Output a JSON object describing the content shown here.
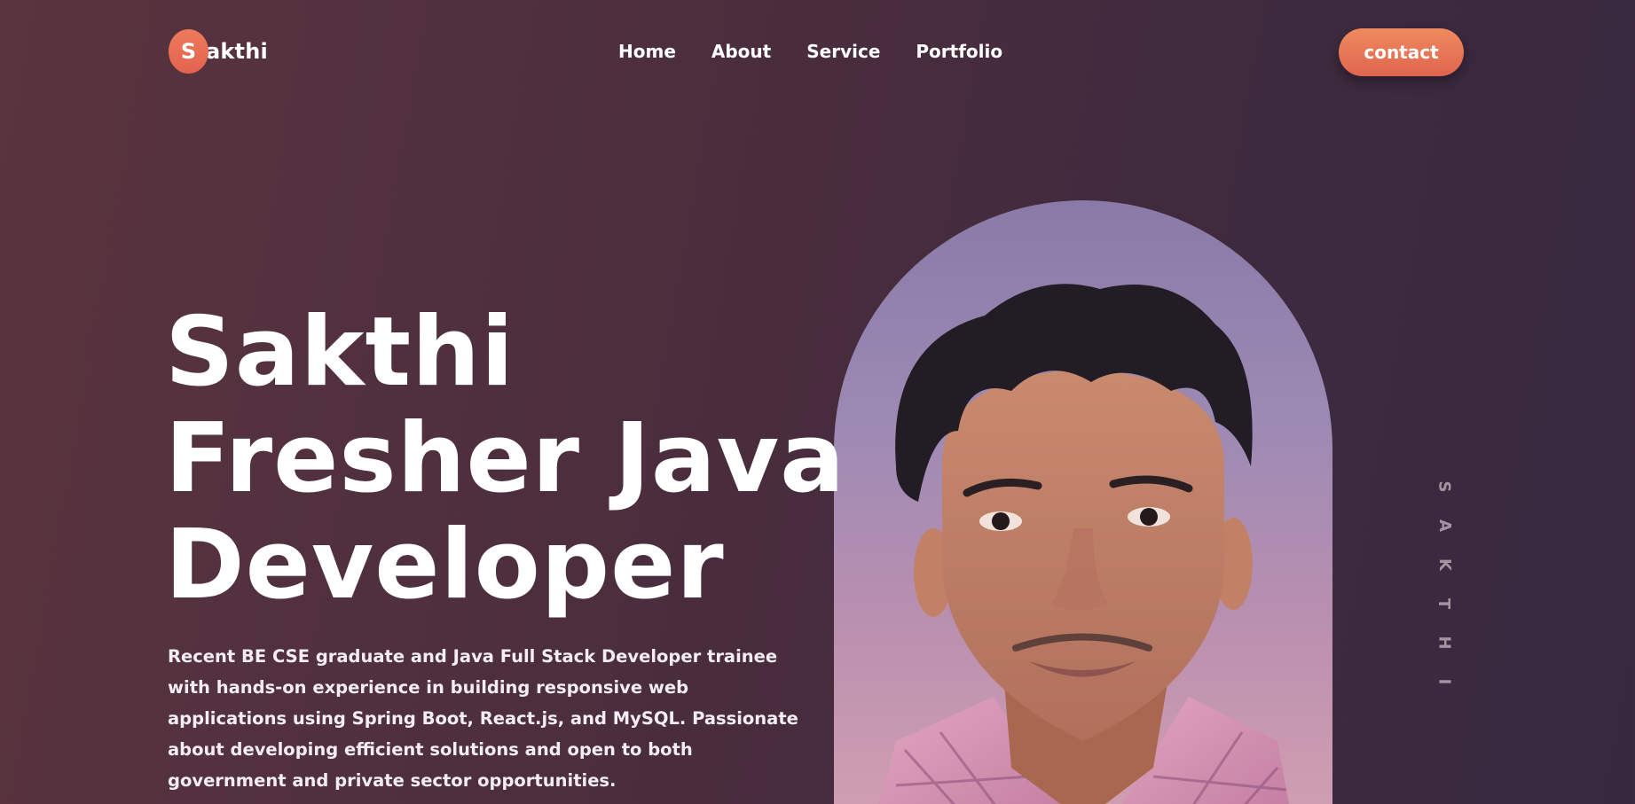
{
  "header": {
    "logo_initial": "S",
    "logo_rest": "akthi",
    "nav": [
      "Home",
      "About",
      "Service",
      "Portfolio"
    ],
    "contact_label": "contact"
  },
  "hero": {
    "title_lines": [
      "Sakthi",
      "Fresher Java",
      "Developer"
    ],
    "description": "Recent BE CSE graduate and Java Full Stack Developer trainee with hands-on experience in building responsive web applications using Spring Boot, React.js, and MySQL. Passionate about developing efficient solutions and open to both government and private sector opportunities."
  },
  "side_name": [
    "S",
    "A",
    "K",
    "T",
    "H",
    "I"
  ],
  "colors": {
    "accent": "#e9714f",
    "bg_start": "#5a343e",
    "bg_end": "#372840"
  }
}
